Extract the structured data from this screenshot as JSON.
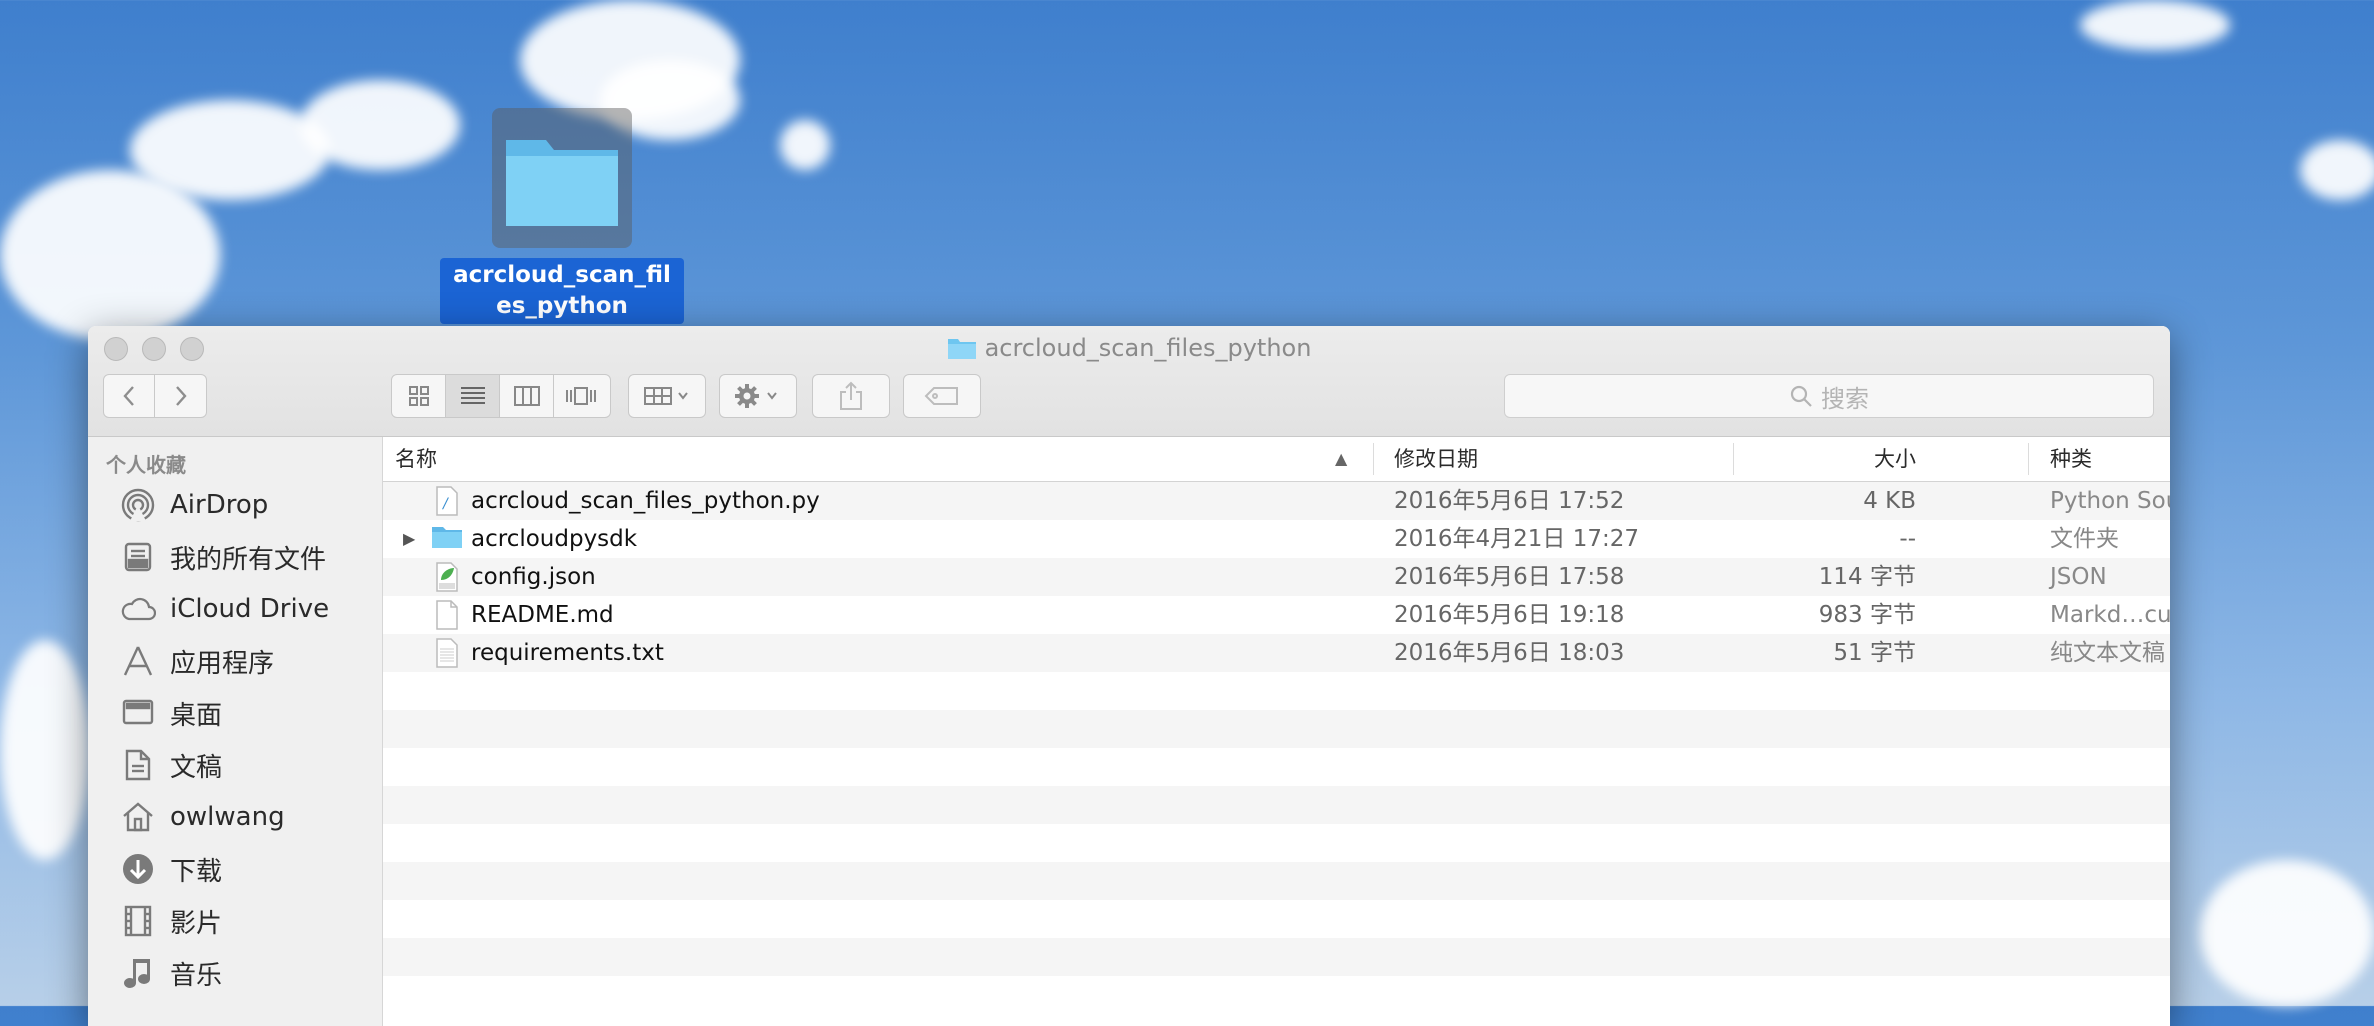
{
  "desktop": {
    "folder_label": "acrcloud_scan_files_python"
  },
  "window": {
    "title": "acrcloud_scan_files_python",
    "search_placeholder": "搜索"
  },
  "sidebar": {
    "section_title": "个人收藏",
    "items": [
      {
        "label": "AirDrop",
        "icon": "airdrop-icon"
      },
      {
        "label": "我的所有文件",
        "icon": "all-files-icon"
      },
      {
        "label": "iCloud Drive",
        "icon": "icloud-icon"
      },
      {
        "label": "应用程序",
        "icon": "applications-icon"
      },
      {
        "label": "桌面",
        "icon": "desktop-icon"
      },
      {
        "label": "文稿",
        "icon": "documents-icon"
      },
      {
        "label": "owlwang",
        "icon": "home-icon"
      },
      {
        "label": "下载",
        "icon": "downloads-icon"
      },
      {
        "label": "影片",
        "icon": "movies-icon"
      },
      {
        "label": "音乐",
        "icon": "music-icon"
      }
    ]
  },
  "list": {
    "columns": {
      "name": "名称",
      "date": "修改日期",
      "size": "大小",
      "kind": "种类"
    },
    "files": [
      {
        "name": "acrcloud_scan_files_python.py",
        "date": "2016年5月6日 17:52",
        "size": "4 KB",
        "kind": "Python Source",
        "icon": "python-file-icon"
      },
      {
        "name": "acrcloudpysdk",
        "date": "2016年4月21日 17:27",
        "size": "--",
        "kind": "文件夹",
        "icon": "folder-icon"
      },
      {
        "name": "config.json",
        "date": "2016年5月6日 17:58",
        "size": "114 字节",
        "kind": "JSON",
        "icon": "json-file-icon"
      },
      {
        "name": "README.md",
        "date": "2016年5月6日 19:18",
        "size": "983 字节",
        "kind": "Markd…cument",
        "icon": "markdown-file-icon"
      },
      {
        "name": "requirements.txt",
        "date": "2016年5月6日 18:03",
        "size": "51 字节",
        "kind": "纯文本文稿",
        "icon": "text-file-icon"
      }
    ]
  },
  "colors": {
    "selection": "#1b64d4",
    "folder": "#6ec6f0"
  }
}
